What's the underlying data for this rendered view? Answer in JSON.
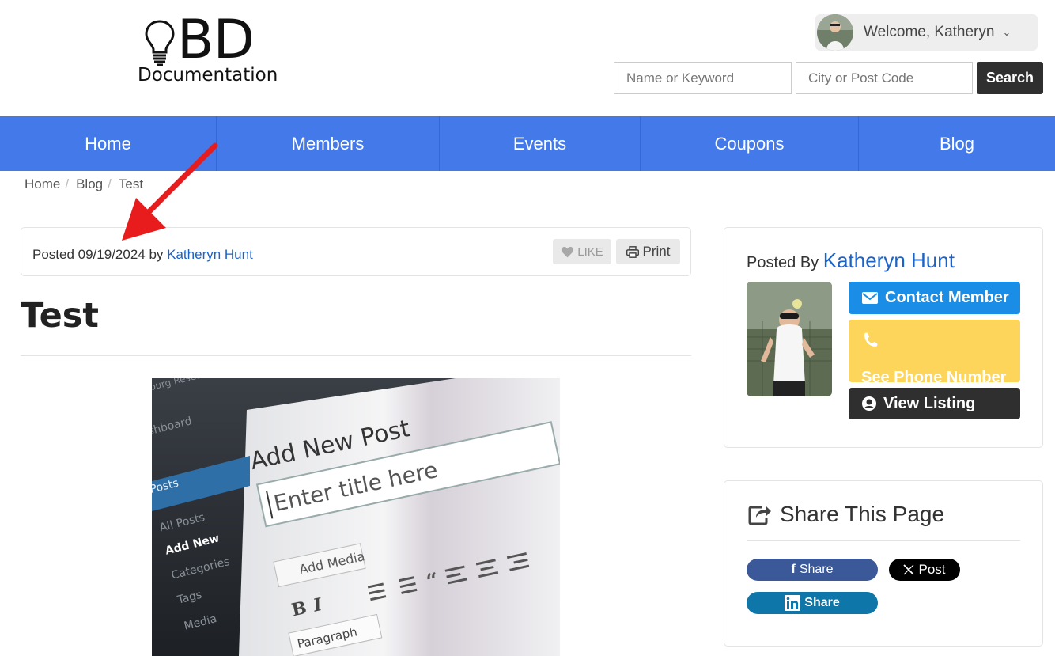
{
  "header": {
    "logo_mark": "BD",
    "logo_text": "Documentation",
    "welcome": "Welcome, Katheryn",
    "search": {
      "keyword_placeholder": "Name or Keyword",
      "location_placeholder": "City or Post Code",
      "button_label": "Search"
    }
  },
  "nav": {
    "items": [
      {
        "label": "Home"
      },
      {
        "label": "Members"
      },
      {
        "label": "Events"
      },
      {
        "label": "Coupons"
      },
      {
        "label": "Blog"
      }
    ]
  },
  "breadcrumb": [
    "Home",
    "Blog",
    "Test"
  ],
  "post": {
    "posted_prefix": "Posted 09/19/2024 by ",
    "author": "Katheryn Hunt",
    "like_label": "LIKE",
    "print_label": "Print",
    "title": "Test",
    "image_text": {
      "heading": "Add New Post",
      "title_placeholder": "Enter title here",
      "add_media": "Add Media",
      "paragraph": "Paragraph",
      "menu": [
        "Dashboard",
        "Posts",
        "All Posts",
        "Add New",
        "Categories",
        "Tags",
        "Media"
      ],
      "brand": "Salzburg Research"
    }
  },
  "sidebar": {
    "posted_by_label": "Posted By",
    "author": "Katheryn Hunt",
    "contact_label": "Contact Member",
    "phone_label": "See Phone Number",
    "listing_label": "View Listing",
    "share_title": "Share This Page",
    "share": {
      "facebook": "Share",
      "x": "Post",
      "linkedin": "Share"
    }
  },
  "colors": {
    "nav": "#4479ea",
    "link": "#1b63c6",
    "contact": "#1a8ee6",
    "phone": "#fdd55a",
    "dark": "#2f2f2f",
    "annotation_arrow": "#e81c1c"
  }
}
